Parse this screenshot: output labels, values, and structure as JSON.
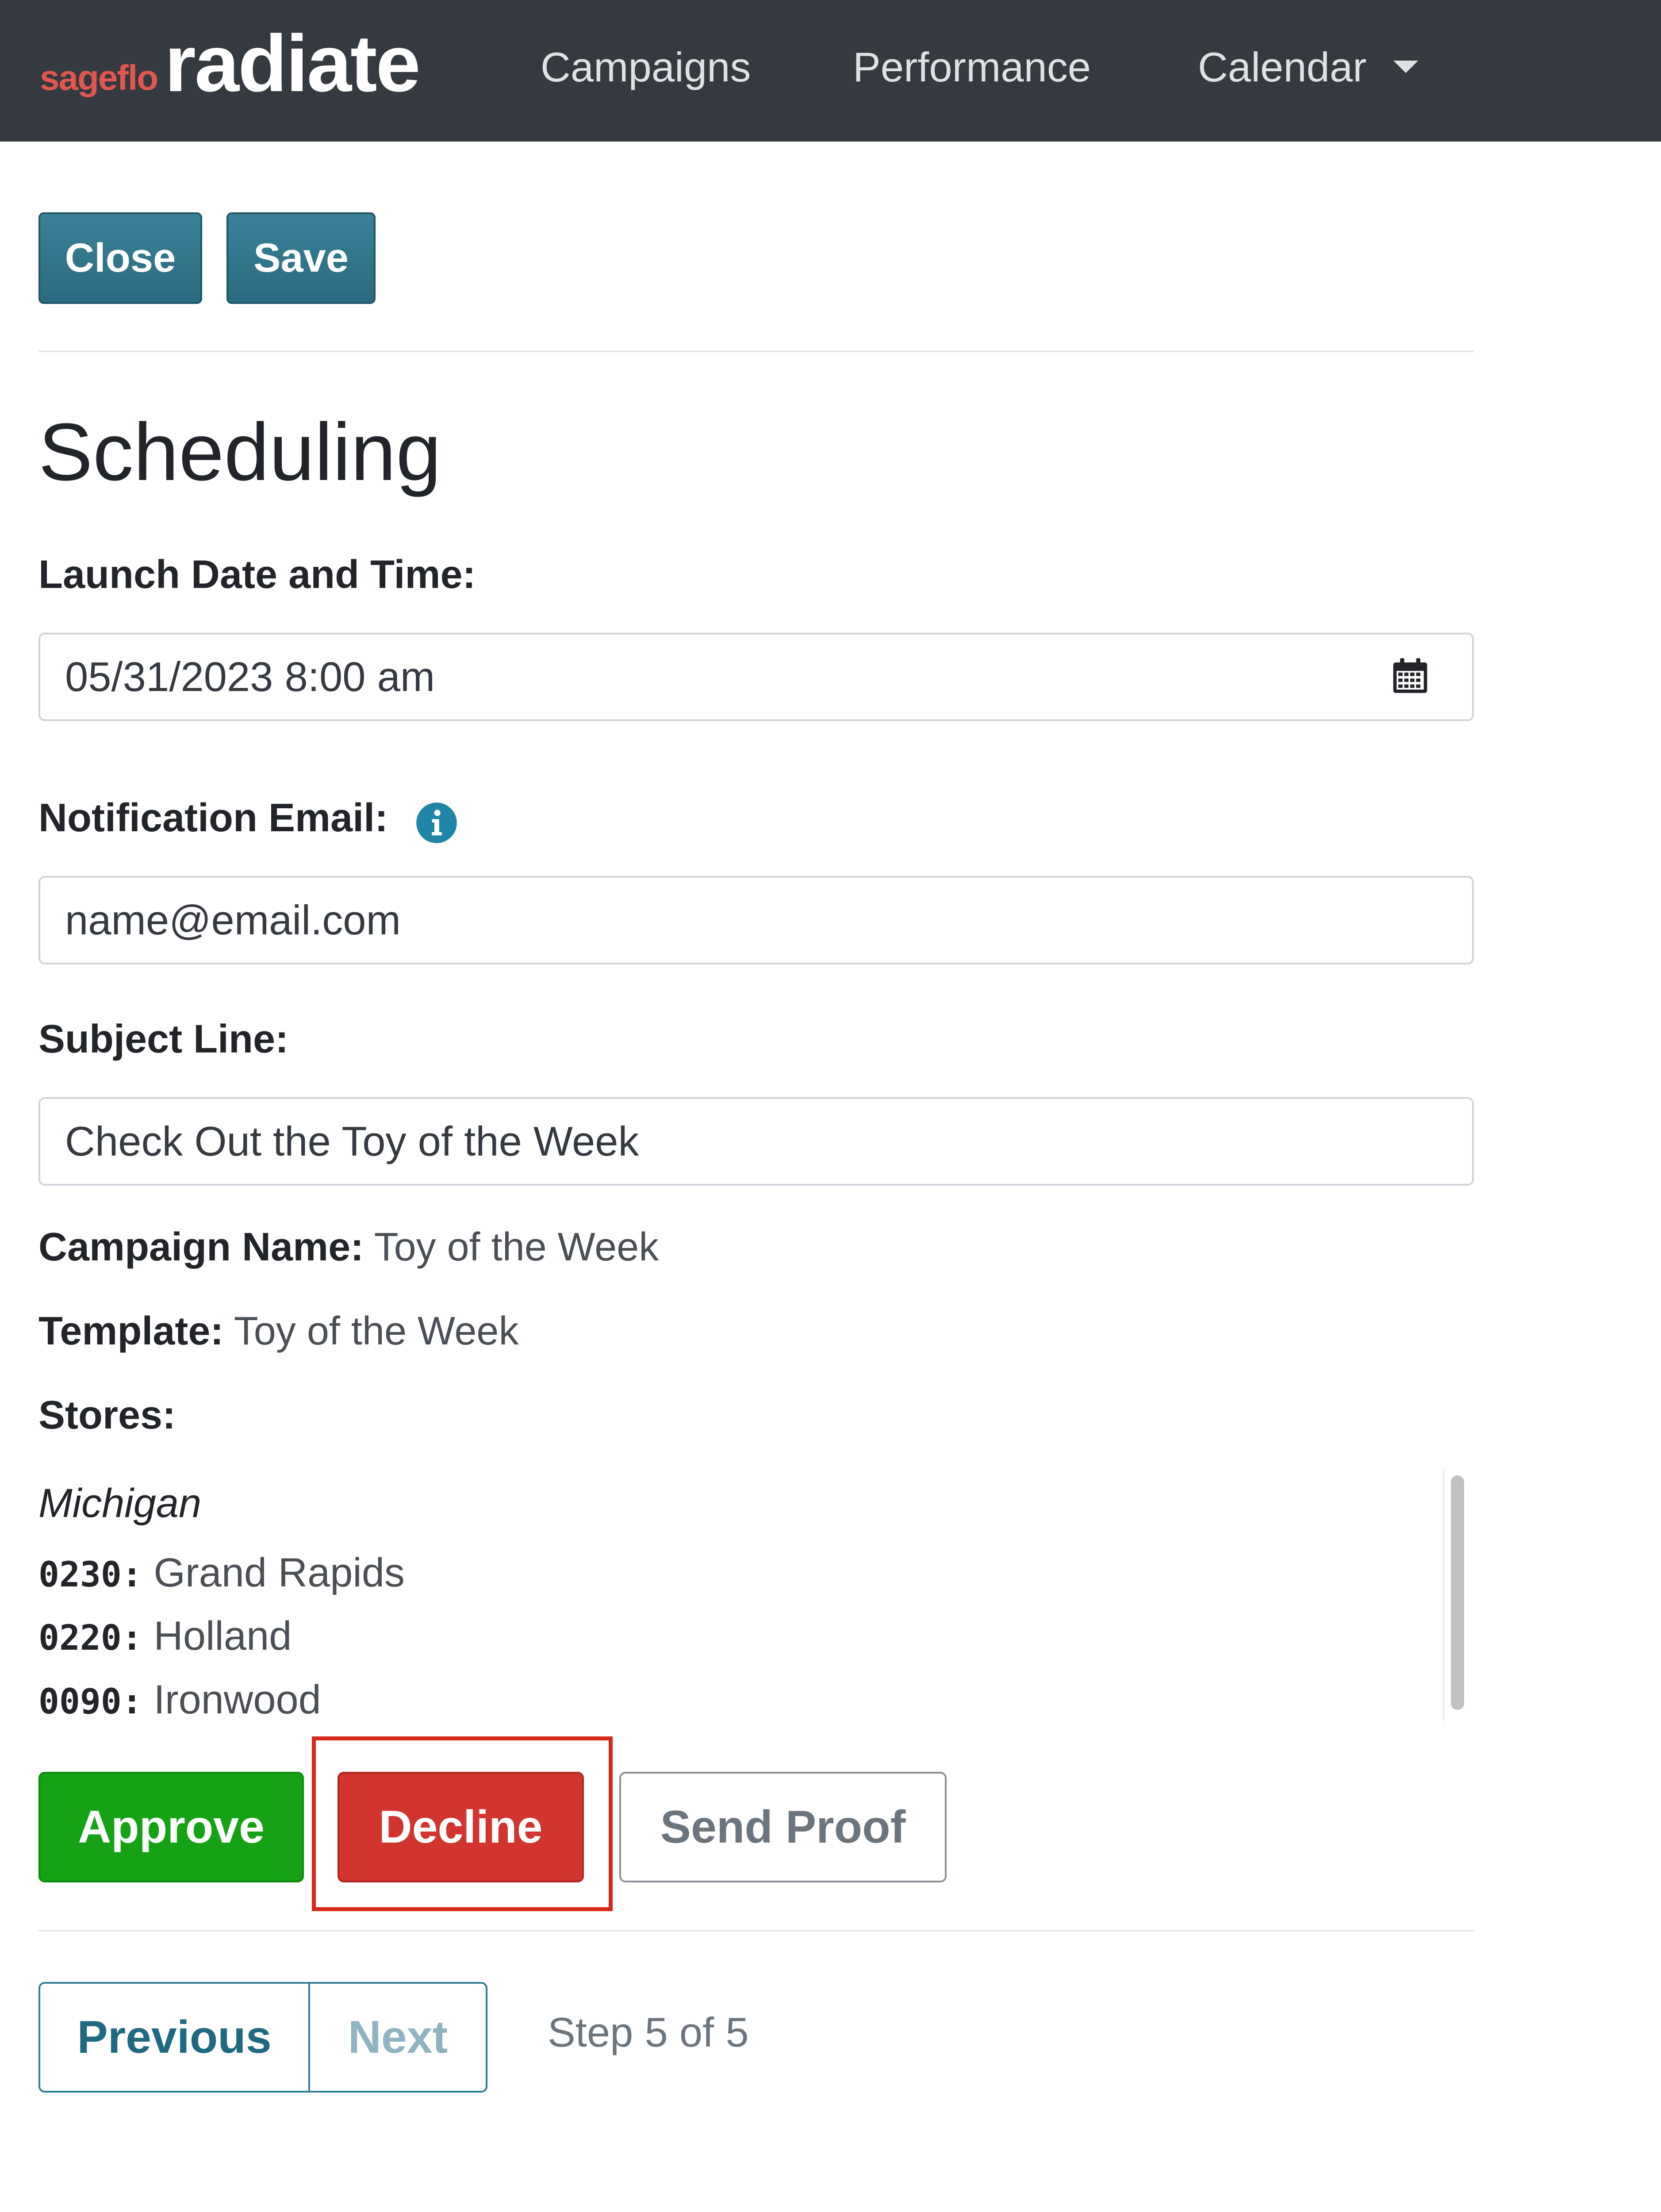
{
  "navbar": {
    "brand_small": "sageflo",
    "brand_big": "radiate",
    "links": [
      "Campaigns",
      "Performance",
      "Calendar"
    ]
  },
  "toolbar": {
    "close_label": "Close",
    "save_label": "Save"
  },
  "page": {
    "title": "Scheduling"
  },
  "form": {
    "launch_label": "Launch Date and Time:",
    "launch_value": "05/31/2023 8:00 am",
    "email_label": "Notification Email:",
    "email_value": "name@email.com",
    "subject_label": "Subject Line:",
    "subject_value": "Check Out the Toy of the Week"
  },
  "meta": {
    "campaign_key": "Campaign Name:",
    "campaign_value": "Toy of the Week",
    "template_key": "Template:",
    "template_value": "Toy of the Week",
    "stores_key": "Stores:"
  },
  "stores": {
    "region": "Michigan",
    "items": [
      {
        "code": "0230:",
        "name": "Grand Rapids"
      },
      {
        "code": "0220:",
        "name": "Holland"
      },
      {
        "code": "0090:",
        "name": "Ironwood"
      }
    ]
  },
  "actions": {
    "approve_label": "Approve",
    "decline_label": "Decline",
    "proof_label": "Send Proof"
  },
  "pagination": {
    "previous_label": "Previous",
    "next_label": "Next",
    "step_text": "Step 5 of 5"
  },
  "colors": {
    "navbar_bg": "#343a40",
    "brand_accent": "#e0574f",
    "teal": "#2f7c93",
    "approve": "#15a315",
    "decline": "#d2352f",
    "highlight": "#d8281a"
  },
  "icons": {
    "info": "info-icon",
    "calendar": "calendar-icon",
    "caret": "chevron-down-icon"
  }
}
